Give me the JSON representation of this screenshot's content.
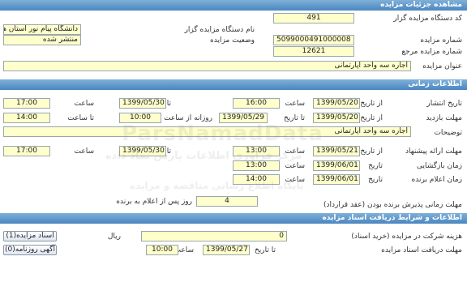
{
  "sections": {
    "details": "مشاهده جزئیات مزایده",
    "timing": "اطلاعات زمانی",
    "conditions": "اطلاعات و شرایط دریافت اسناد مزایده"
  },
  "details": {
    "auctioneer_code_label": "کد دستگاه مزایده گزار",
    "auctioneer_code": "491",
    "auctioneer_name_label": "نام دستگاه مزایده گزار",
    "auctioneer_name": "دانشگاه پیام نور استان همدان",
    "auction_number_label": "شماره مزایده",
    "auction_number": "5099000491000008",
    "auction_status_label": "وضعیت مزایده",
    "auction_status": "منتشر شده",
    "reference_number_label": "شماره مزایده مرجع",
    "reference_number": "12621",
    "title_label": "عنوان مزایده",
    "title": "اجاره سه واحد آپارتمانی"
  },
  "timing": {
    "publish_label": "تاریخ انتشار",
    "from_date_label": "از تاریخ",
    "to_date_label": "تا تاریخ",
    "time_label": "ساعت",
    "daily_from_label": "روزانه از ساعت",
    "to_time_label": "تا ساعت",
    "publish_from_date": "1399/05/20",
    "publish_from_time": "16:00",
    "publish_to_date": "1399/05/30",
    "publish_to_time": "17:00",
    "visit_label": "مهلت بازدید",
    "visit_from_date": "1399/05/20",
    "visit_to_date": "1399/05/29",
    "visit_daily_from": "10:00",
    "visit_daily_to": "14:00",
    "description_label": "توضیحات",
    "description": "اجاره سه واحد آپارتمانی",
    "submit_label": "مهلت ارائه پیشنهاد",
    "submit_from_date": "1399/05/21",
    "submit_from_time": "13:00",
    "submit_to_date": "1399/05/30",
    "submit_to_time": "17:00",
    "opening_label": "زمان بازگشایی",
    "opening_date": "1399/06/01",
    "opening_time": "13:00",
    "winner_label": "زمان اعلام برنده",
    "winner_date": "1399/06/01",
    "winner_time": "14:00",
    "date_label": "تاریخ",
    "acceptance_label": "مهلت زمانی پذیرش برنده بودن (عقد قرارداد)",
    "acceptance_days": "4",
    "acceptance_suffix": "روز پس از اعلام به برنده"
  },
  "conditions": {
    "fee_label": "هزینه شرکت در مزایده (خرید اسناد)",
    "fee_value": "0",
    "currency": "ریال",
    "doc_deadline_label": "مهلت دریافت اسناد مزایده",
    "doc_deadline_date": "1399/05/27",
    "doc_deadline_time": "10:00",
    "doc_button": "اسناد مزایده(1)",
    "ad_button": "آگهی روزنامه(0)"
  },
  "watermark": {
    "line1": "ParsNamadData",
    "line2": "مرکز فراوری اطلاعات پارس نماد داده",
    "line3": "پایگاه اطلاع رسانی مناقصه و مزایده"
  }
}
